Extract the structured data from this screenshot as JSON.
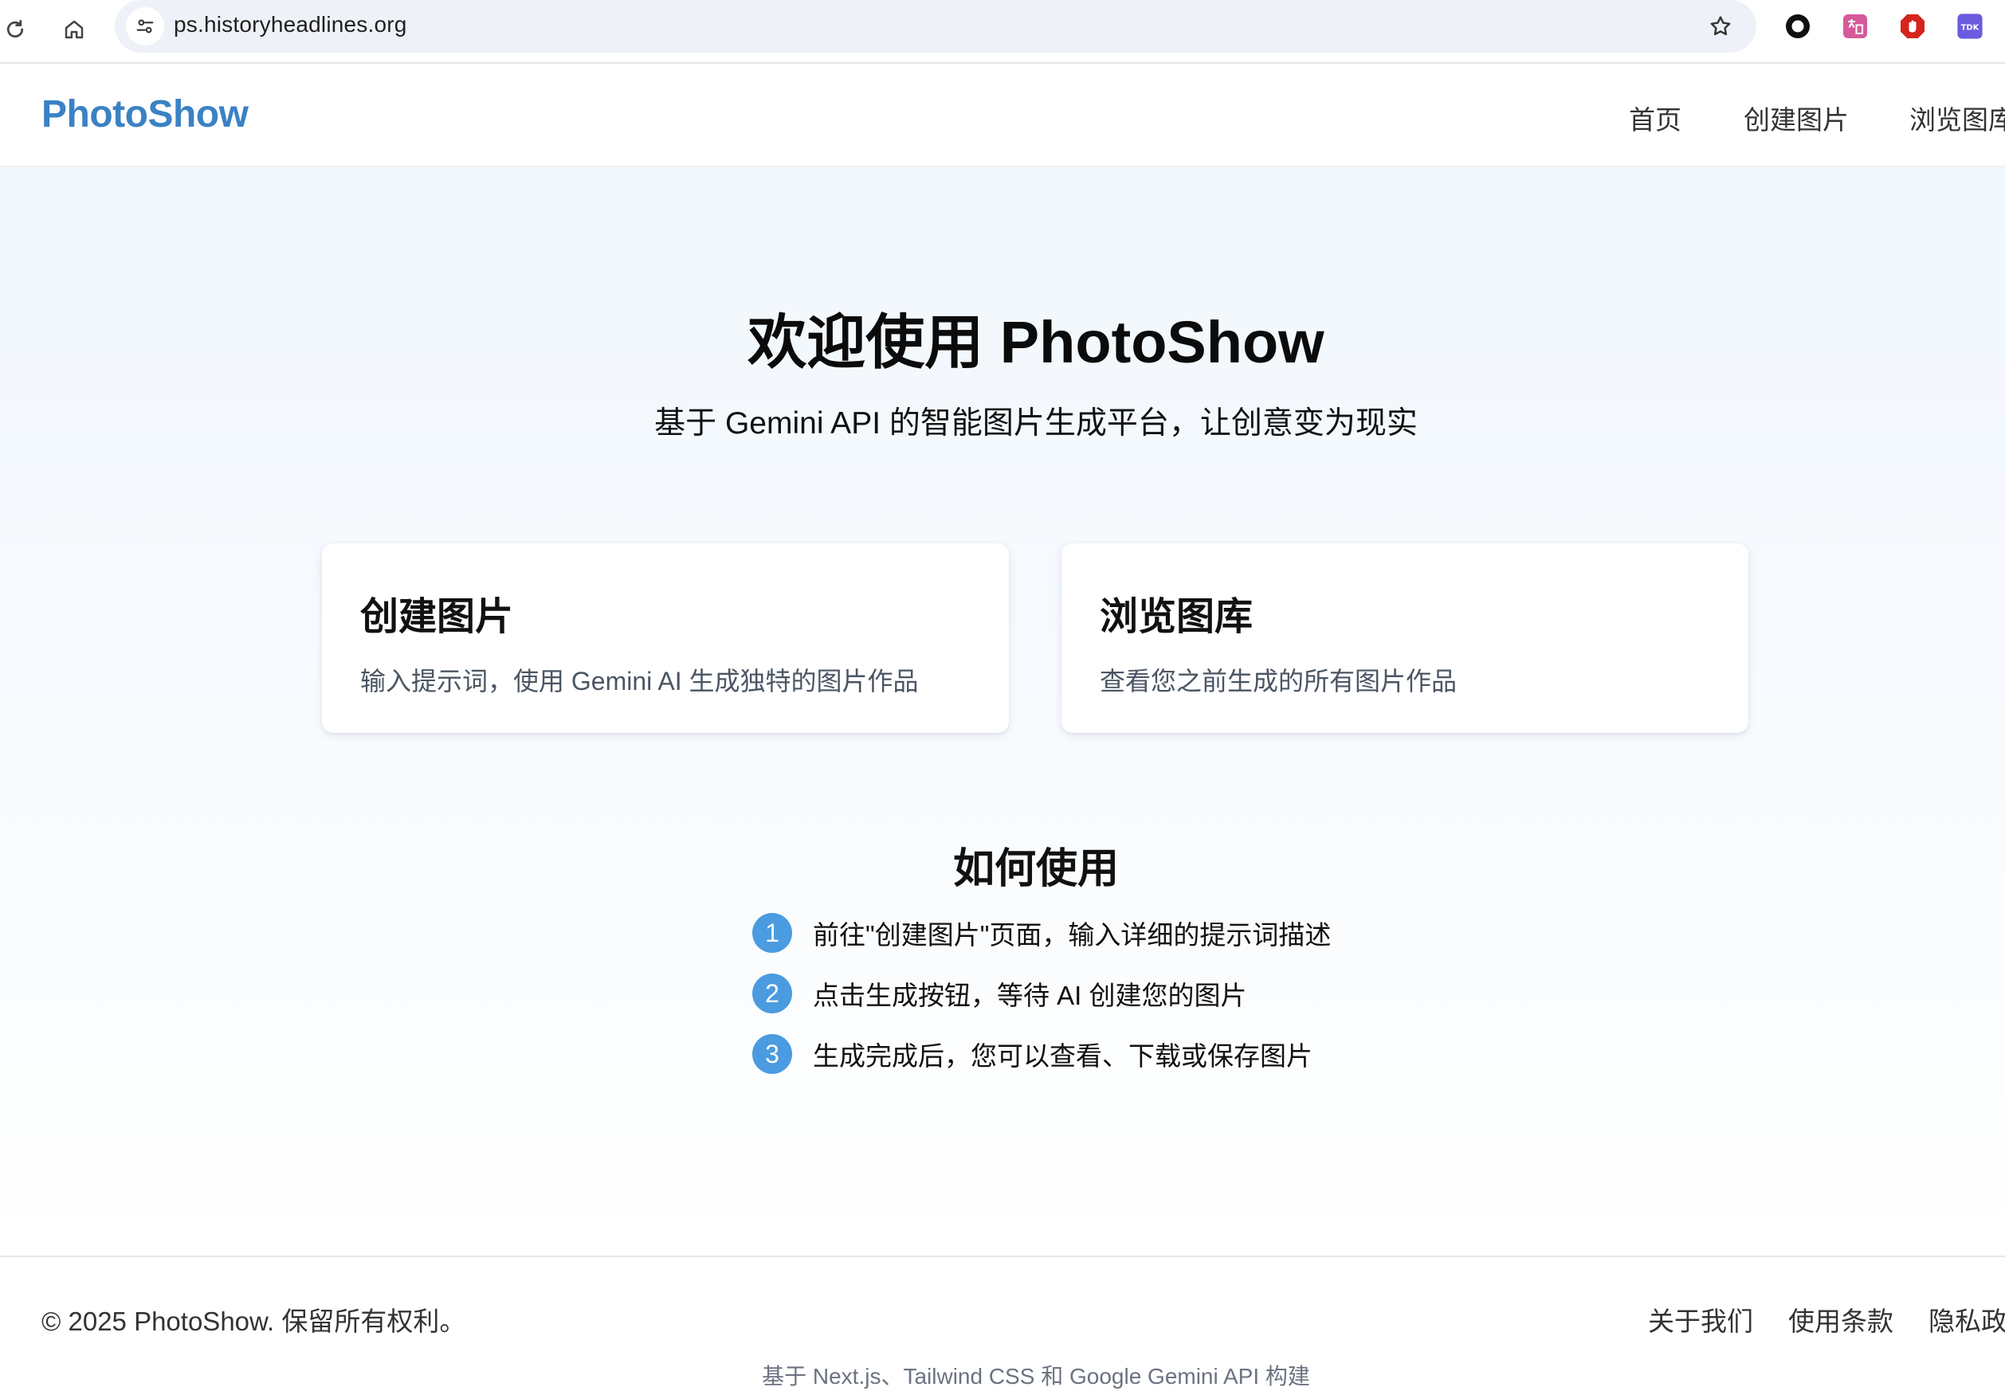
{
  "browser": {
    "url": "ps.historyheadlines.org",
    "extensions": [
      "tdk-extension-icon"
    ]
  },
  "header": {
    "logo": "PhotoShow",
    "nav": [
      "首页",
      "创建图片",
      "浏览图库"
    ]
  },
  "hero": {
    "title": "欢迎使用 PhotoShow",
    "subtitle": "基于 Gemini API 的智能图片生成平台，让创意变为现实"
  },
  "cards": [
    {
      "title": "创建图片",
      "desc": "输入提示词，使用 Gemini AI 生成独特的图片作品"
    },
    {
      "title": "浏览图库",
      "desc": "查看您之前生成的所有图片作品"
    }
  ],
  "howto": {
    "title": "如何使用",
    "steps": [
      {
        "num": "1",
        "text": "前往\"创建图片\"页面，输入详细的提示词描述"
      },
      {
        "num": "2",
        "text": "点击生成按钮，等待 AI 创建您的图片"
      },
      {
        "num": "3",
        "text": "生成完成后，您可以查看、下载或保存图片"
      }
    ]
  },
  "footer": {
    "copyright": "© 2025 PhotoShow. 保留所有权利。",
    "links": [
      "关于我们",
      "使用条款",
      "隐私政策"
    ],
    "built_with": "基于 Next.js、Tailwind CSS 和 Google Gemini API 构建"
  },
  "colors": {
    "brand": "#3a82c4",
    "step_badge": "#4a9be0",
    "main_bg": "#f1f7fd"
  }
}
